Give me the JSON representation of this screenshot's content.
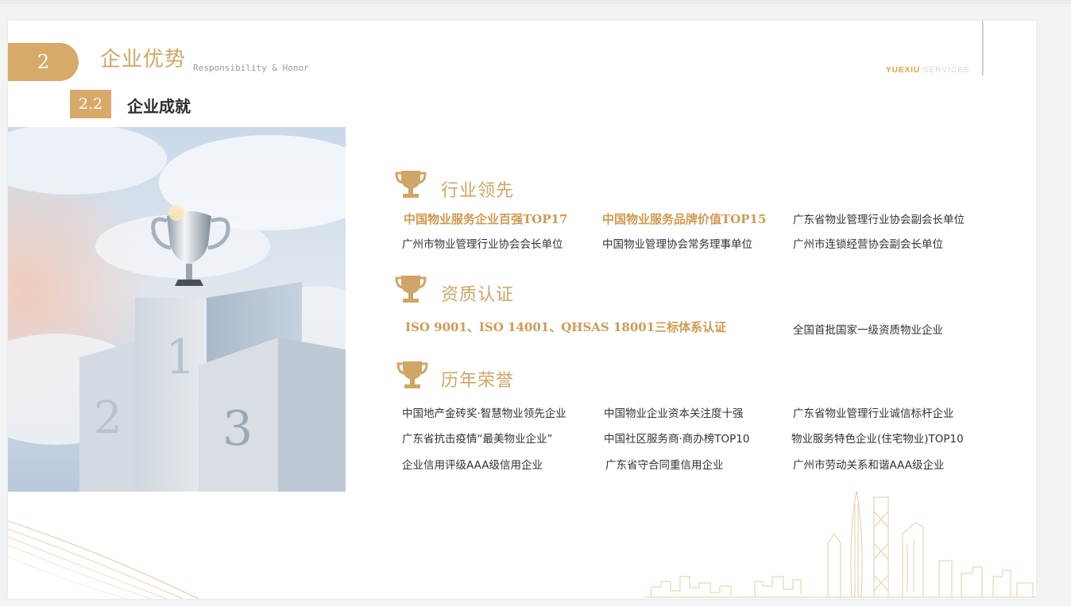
{
  "header": {
    "section_number": "2",
    "section_title": "企业优势",
    "section_subtitle": "Responsibility & Honor",
    "brand_primary": "YUEXIU",
    "brand_secondary": "SERVICES",
    "subsection_number": "2.2",
    "subsection_title": "企业成就"
  },
  "colors": {
    "accent": "#d7aa6a",
    "accent_text": "#d1a565",
    "brand_orange": "#e4a43a",
    "body_text": "#333333"
  },
  "image": {
    "description_icon": "podium-trophy-photo",
    "podium_labels": [
      "1",
      "2",
      "3"
    ]
  },
  "categories": [
    {
      "icon": "trophy-icon",
      "title": "行业领先",
      "items": [
        "中国物业服务企业百强TOP17",
        "中国物业服务品牌价值TOP15",
        "广东省物业管理行业协会副会长单位",
        "广州市物业管理行业协会会长单位",
        "中国物业管理协会常务理事单位",
        "广州市连锁经营协会副会长单位"
      ]
    },
    {
      "icon": "trophy-icon",
      "title": "资质认证",
      "items": [
        "ISO 9001、ISO 14001、QHSAS 18001三标体系认证",
        "全国首批国家一级资质物业企业"
      ]
    },
    {
      "icon": "trophy-icon",
      "title": "历年荣誉",
      "items": [
        "中国地产金砖奖·智慧物业领先企业",
        "中国物业企业资本关注度十强",
        "广东省物业管理行业诚信标杆企业",
        "广东省抗击疫情“最美物业企业”",
        "中国社区服务商·商办榜TOP10",
        "物业服务特色企业(住宅物业)TOP10",
        "企业信用评级AAA级信用企业",
        "广东省守合同重信用企业",
        "广州市劳动关系和谐AAA级企业"
      ]
    }
  ]
}
